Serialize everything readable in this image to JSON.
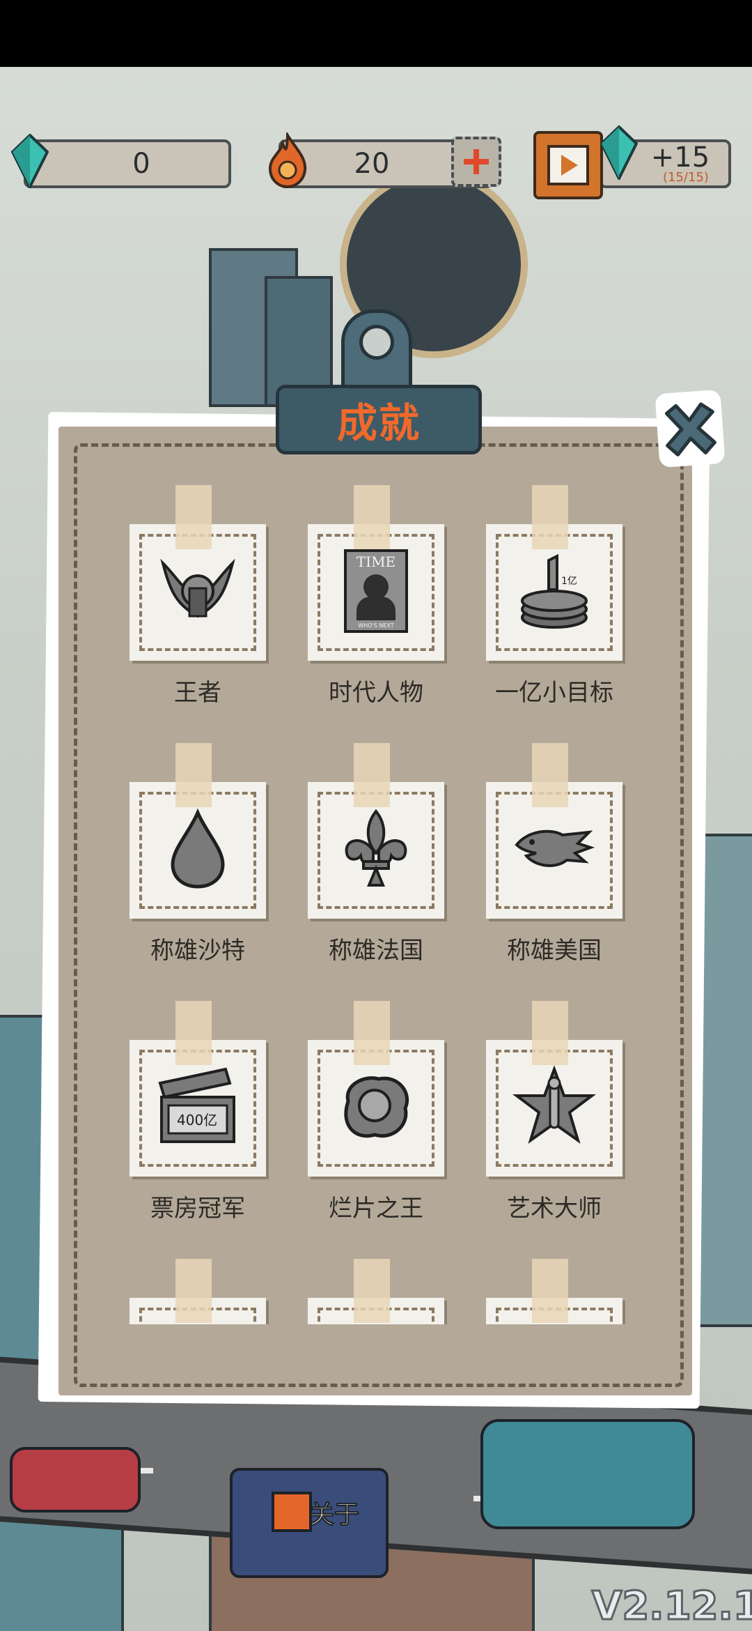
{
  "hud": {
    "gems": "0",
    "energy": "20",
    "reward": "+15",
    "reward_sub": "(15/15)"
  },
  "dialog": {
    "title": "成就",
    "achievements": [
      {
        "label": "王者",
        "icon": "winged-emblem-icon"
      },
      {
        "label": "时代人物",
        "icon": "time-magazine-icon"
      },
      {
        "label": "一亿小目标",
        "icon": "coin-stack-icon"
      },
      {
        "label": "称雄沙特",
        "icon": "oil-drop-icon"
      },
      {
        "label": "称雄法国",
        "icon": "fleur-de-lis-icon"
      },
      {
        "label": "称雄美国",
        "icon": "eagle-icon"
      },
      {
        "label": "票房冠军",
        "icon": "clapperboard-icon"
      },
      {
        "label": "烂片之王",
        "icon": "fried-egg-icon"
      },
      {
        "label": "艺术大师",
        "icon": "oscar-star-icon"
      }
    ],
    "time_magazine_text": "TIME",
    "time_magazine_sub": "WHO'S NEXT",
    "clapper_text": "400亿",
    "coin_text": "1亿"
  },
  "background": {
    "truck_label": "关于"
  },
  "version": "V2.12.1",
  "colors": {
    "title": "#f06a2b",
    "panel": "#b4a999",
    "accent": "#d3742c"
  }
}
